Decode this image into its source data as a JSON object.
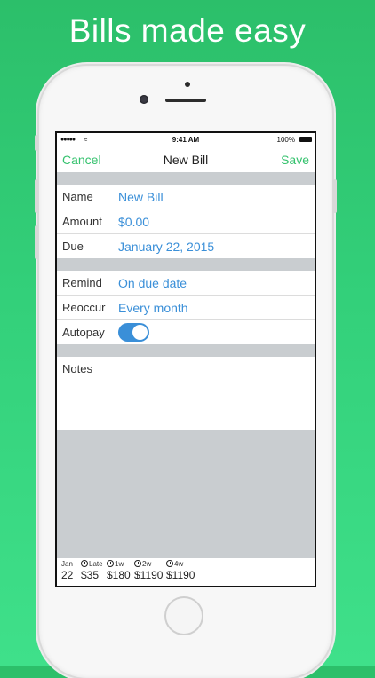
{
  "headline": "Bills made easy",
  "status": {
    "time": "9:41 AM",
    "battery": "100%"
  },
  "nav": {
    "cancel": "Cancel",
    "title": "New Bill",
    "save": "Save"
  },
  "form": {
    "name_label": "Name",
    "name_value": "New Bill",
    "amount_label": "Amount",
    "amount_value": "$0.00",
    "due_label": "Due",
    "due_value": "January 22, 2015",
    "remind_label": "Remind",
    "remind_value": "On due date",
    "reoccur_label": "Reoccur",
    "reoccur_value": "Every month",
    "autopay_label": "Autopay",
    "autopay_on": true,
    "notes_label": "Notes"
  },
  "footer": {
    "c0": {
      "top": "Jan",
      "bot": "22"
    },
    "c1": {
      "top": "Late",
      "bot": "$35"
    },
    "c2": {
      "top": "1w",
      "bot": "$180"
    },
    "c3": {
      "top": "2w",
      "bot": "$1190"
    },
    "c4": {
      "top": "4w",
      "bot": "$1190"
    }
  },
  "colors": {
    "accent_green": "#35c26e",
    "value_blue": "#3a8fd8",
    "background_green": "#33d07a"
  }
}
